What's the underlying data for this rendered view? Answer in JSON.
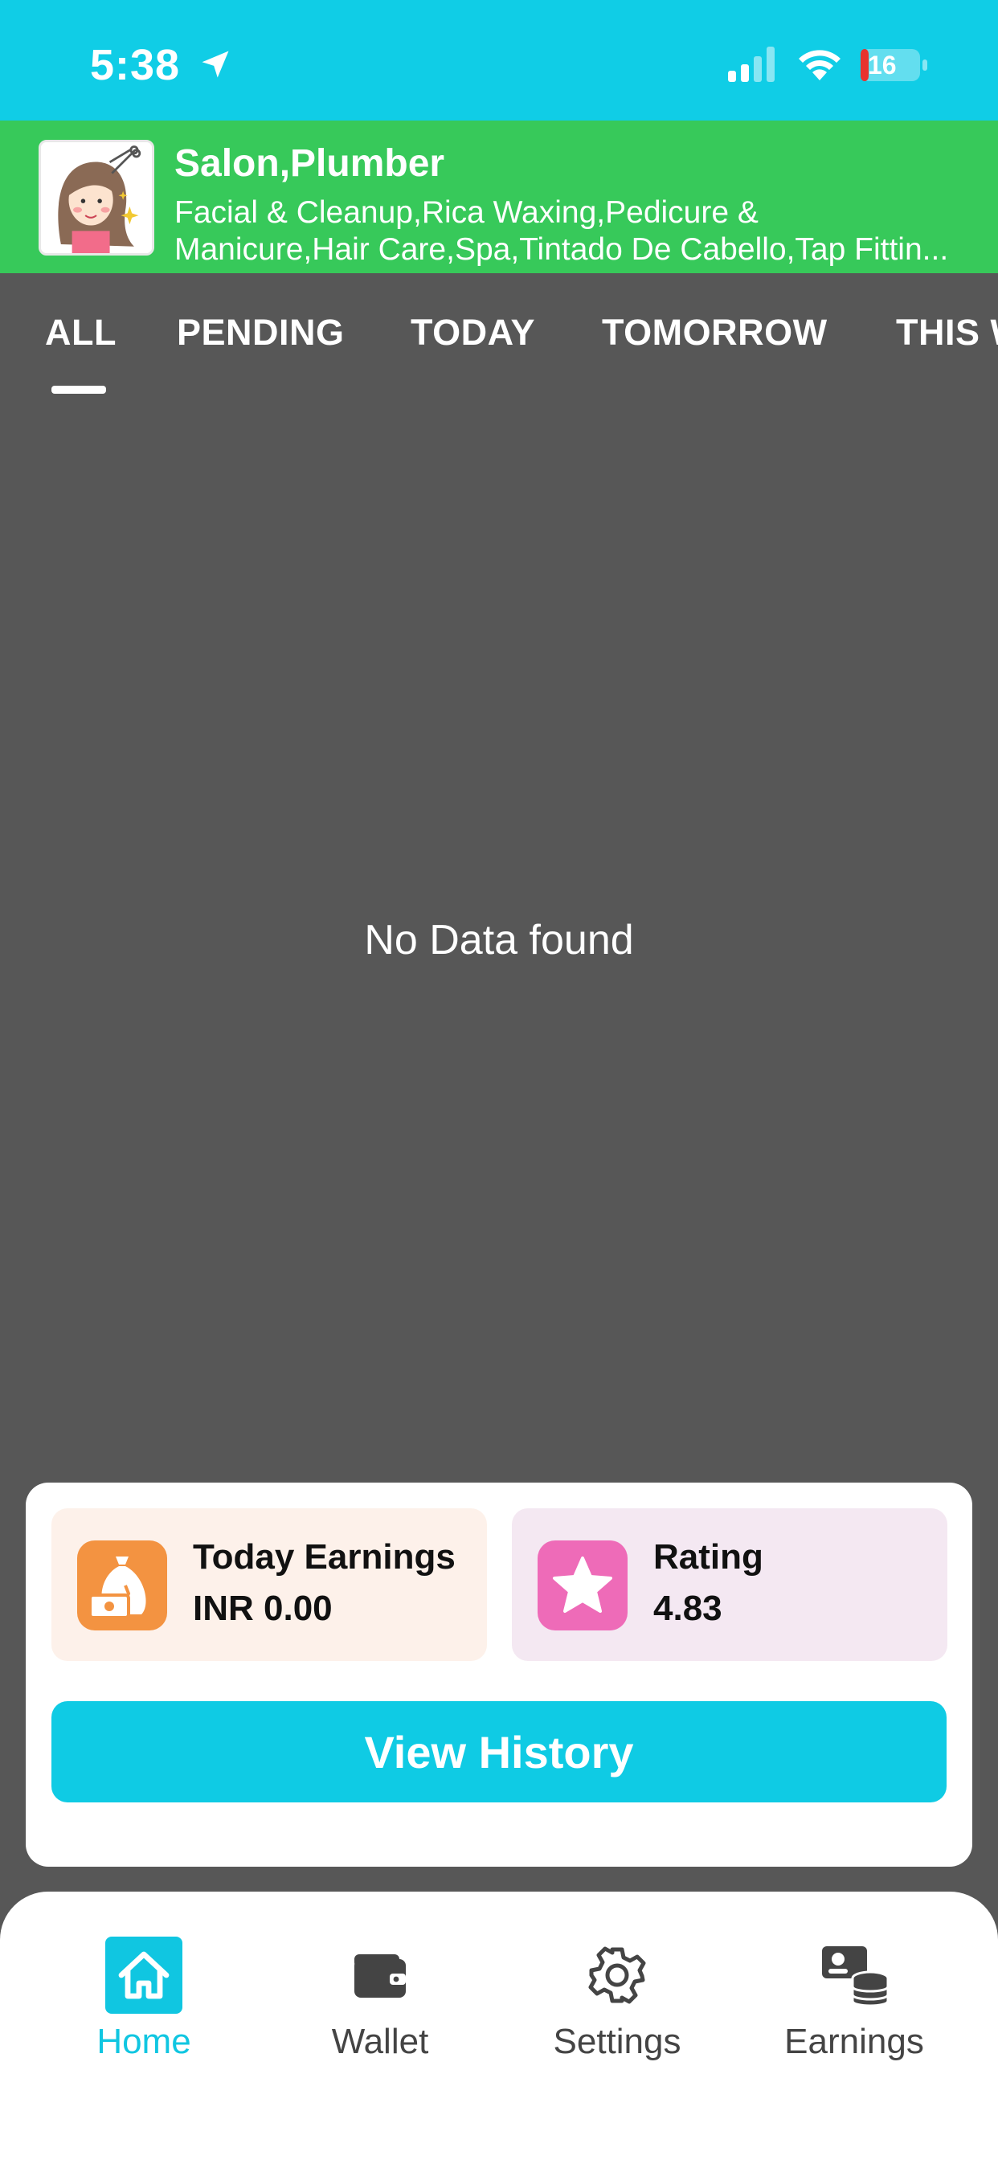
{
  "status_bar": {
    "time": "5:38",
    "battery": "16"
  },
  "header": {
    "title": "Salon,Plumber",
    "subtitle_line1": "Facial & Cleanup,Rica Waxing,Pedicure &",
    "subtitle_line2": "Manicure,Hair Care,Spa,Tintado De Cabello,Tap Fittin..."
  },
  "tabs": [
    {
      "label": "ALL",
      "active": true
    },
    {
      "label": "PENDING"
    },
    {
      "label": "TODAY"
    },
    {
      "label": "TOMORROW"
    },
    {
      "label": "THIS W"
    }
  ],
  "empty_state": "No Data found",
  "summary": {
    "earnings_label": "Today Earnings",
    "earnings_value": "INR 0.00",
    "rating_label": "Rating",
    "rating_value": "4.83",
    "history_button": "View History"
  },
  "bottom_nav": [
    {
      "label": "Home",
      "icon": "home-icon",
      "active": true
    },
    {
      "label": "Wallet",
      "icon": "wallet-icon"
    },
    {
      "label": "Settings",
      "icon": "gear-icon"
    },
    {
      "label": "Earnings",
      "icon": "earnings-icon"
    }
  ],
  "colors": {
    "primary": "#10CDE6",
    "header_green": "#37C95A",
    "background": "#575757",
    "earnings_icon": "#F39341",
    "rating_icon": "#EE6BB8"
  }
}
